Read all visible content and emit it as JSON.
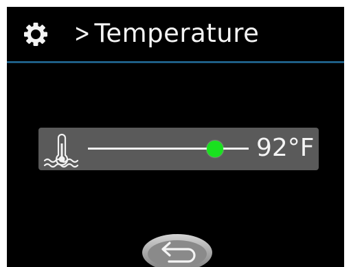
{
  "header": {
    "settings_icon": "gear-icon",
    "separator": ">",
    "title": "Temperature"
  },
  "temperature_control": {
    "icon": "water-thermometer-icon",
    "value_label": "92°F",
    "slider_level": 0.79,
    "knob_color": "#19e11f"
  },
  "footer": {
    "back_icon": "back-arrow-icon"
  },
  "colors": {
    "background": "#000000",
    "divider": "#1e5f86",
    "panel": "#5a5a5a",
    "text": "#f4f4f4"
  }
}
